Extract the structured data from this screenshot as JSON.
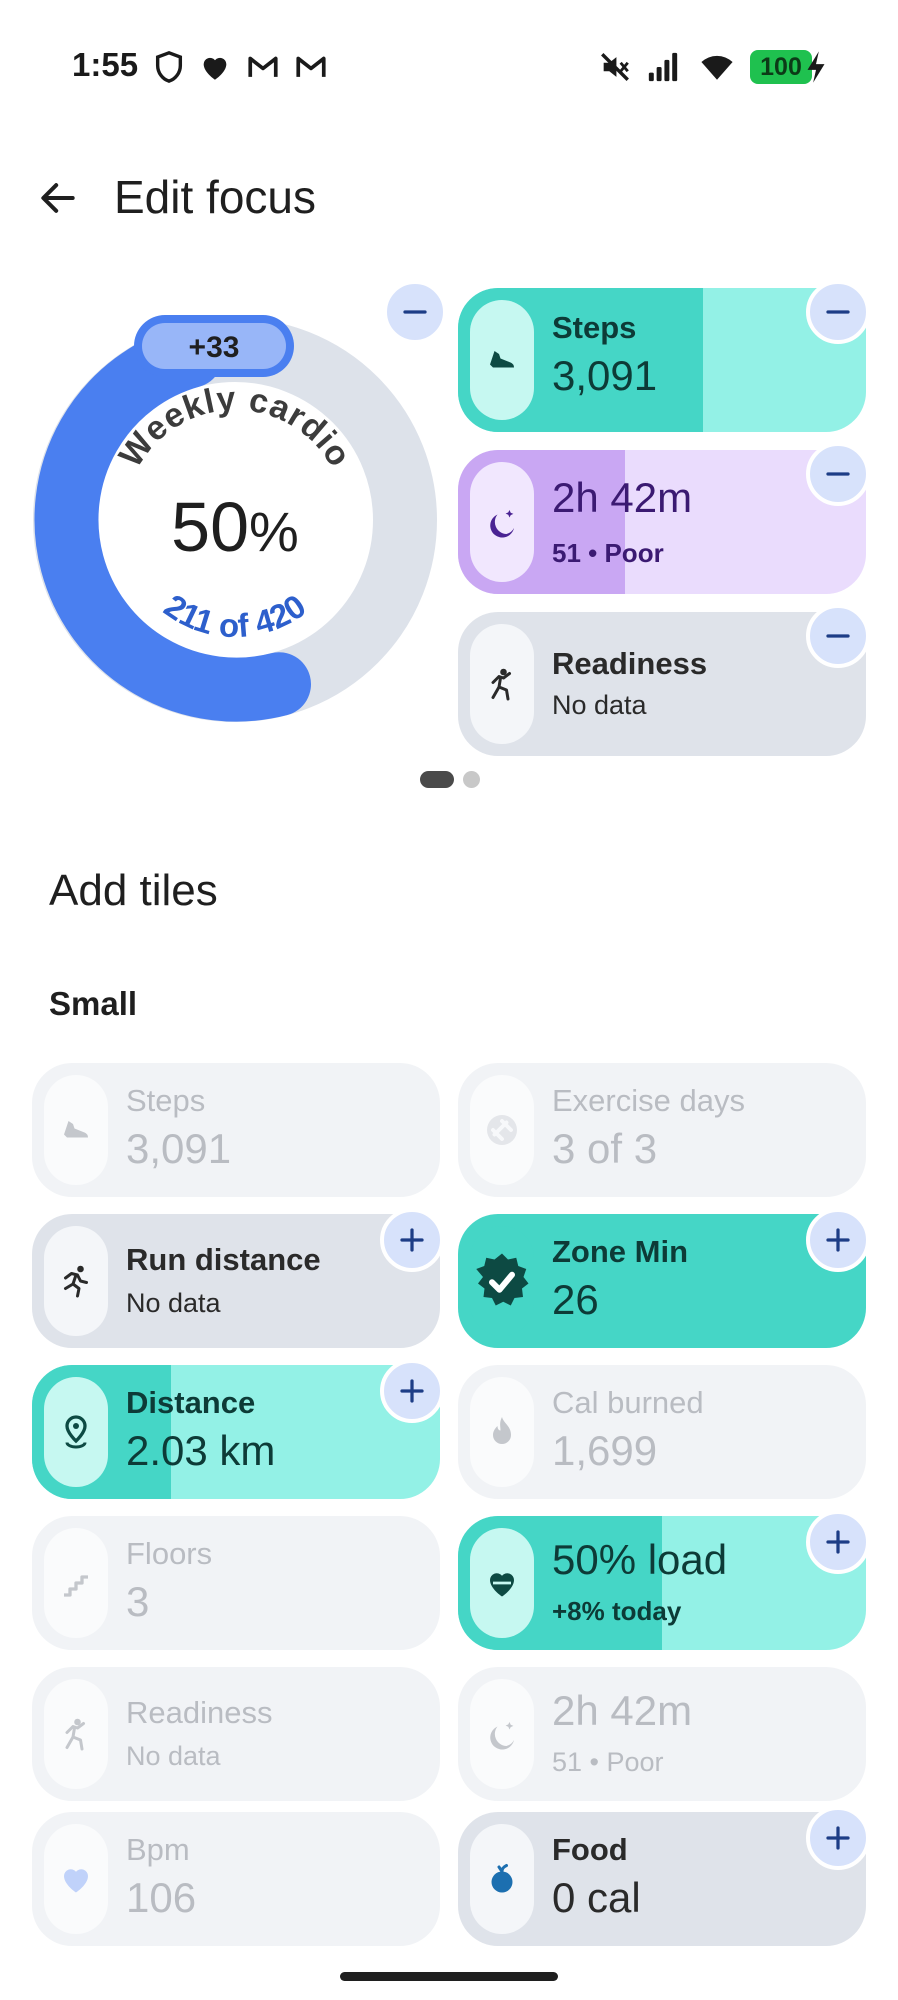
{
  "status_bar": {
    "time": "1:55",
    "battery": "100",
    "icons": [
      "shield-icon",
      "heart-icon",
      "gmail-icon",
      "gmail-icon",
      "mute-icon",
      "signal-icon",
      "wifi-icon",
      "battery-icon",
      "charging-icon"
    ]
  },
  "header": {
    "back_icon": "arrow-back-icon",
    "title": "Edit focus"
  },
  "weekly_cardio": {
    "label": "Weekly cardio",
    "percent": "50",
    "percent_sign": "%",
    "progress": 0.5,
    "bonus": "+33",
    "progress_text": "211 of 420",
    "colors": {
      "progress": "#4a7ff0",
      "track": "#dde2ea",
      "bonus": "#98b6f8"
    }
  },
  "focus_tiles": [
    {
      "label": "Steps",
      "value": "3,091",
      "icon": "shoe-icon",
      "fill": 0.6,
      "color": "#45d6c6",
      "light": "#93f1e6"
    },
    {
      "value": "2h 42m",
      "sub": "51 • Poor",
      "icon": "moon-icon",
      "fill": 0.41,
      "color": "#c9a7f3",
      "light": "#eadcfd"
    },
    {
      "label": "Readiness",
      "sub": "No data",
      "icon": "person-icon",
      "color": "#dfe3ea"
    }
  ],
  "add_tiles": {
    "title": "Add tiles",
    "subtitle": "Small",
    "items": [
      {
        "label": "Steps",
        "value": "3,091",
        "icon": "shoe-icon",
        "state": "added"
      },
      {
        "label": "Exercise days",
        "value": "3 of 3",
        "icon": "dumbbell-badge-icon",
        "state": "added"
      },
      {
        "label": "Run distance",
        "sub": "No data",
        "icon": "runner-icon",
        "state": "available"
      },
      {
        "label": "Zone Min",
        "value": "26",
        "icon": "check-badge-icon",
        "state": "available"
      },
      {
        "label": "Distance",
        "value": "2.03 km",
        "icon": "location-pin-icon",
        "state": "available"
      },
      {
        "label": "Cal burned",
        "value": "1,699",
        "icon": "flame-icon",
        "state": "added"
      },
      {
        "label": "Floors",
        "value": "3",
        "icon": "stairs-icon",
        "state": "added"
      },
      {
        "label": "50% load",
        "sub": "+8% today",
        "icon": "heart-load-icon",
        "state": "available"
      },
      {
        "label": "Readiness",
        "sub": "No data",
        "icon": "person-icon",
        "state": "added"
      },
      {
        "label": "2h 42m",
        "sub": "51 • Poor",
        "icon": "moon-icon",
        "state": "added"
      },
      {
        "label": "Bpm",
        "value": "106",
        "icon": "heart-icon",
        "state": "added"
      },
      {
        "label": "Food",
        "value": "0 cal",
        "icon": "apple-icon",
        "state": "available"
      }
    ]
  }
}
